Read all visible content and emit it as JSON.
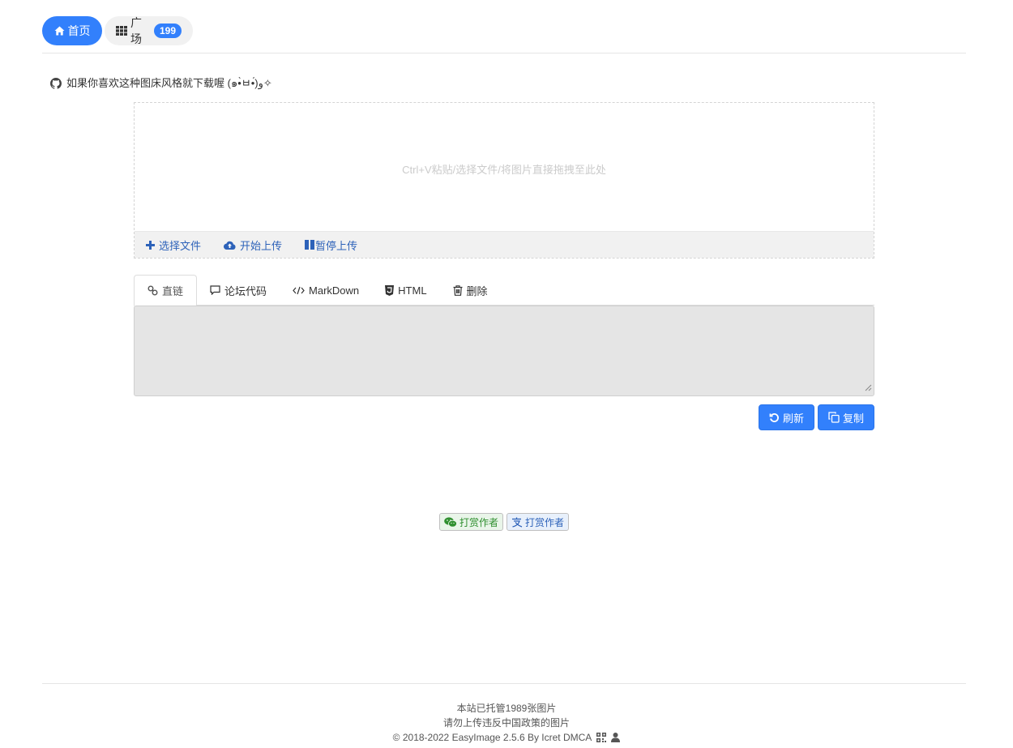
{
  "nav": {
    "home_label": "首页",
    "square_label": "广场",
    "square_count": "199"
  },
  "notice": {
    "text": "如果你喜欢这种图床风格就下载喔 (๑•̀ㅂ•́)و✧"
  },
  "upload": {
    "drop_hint": "Ctrl+V粘贴/选择文件/将图片直接拖拽至此处",
    "choose_label": "选择文件",
    "start_label": "开始上传",
    "pause_label": "暂停上传"
  },
  "tabs": {
    "direct_label": "直链",
    "forum_label": "论坛代码",
    "markdown_label": "MarkDown",
    "html_label": "HTML",
    "delete_label": "删除"
  },
  "result": {
    "value": ""
  },
  "actions": {
    "refresh_label": "刷新",
    "copy_label": "复制"
  },
  "donate": {
    "wechat_label": "打赏作者",
    "alipay_label": "打赏作者"
  },
  "footer": {
    "line1": "本站已托管1989张图片",
    "line2": "请勿上传违反中国政策的图片",
    "line3": "© 2018-2022 EasyImage 2.5.6 By Icret DMCA"
  },
  "colors": {
    "primary": "#3280fc",
    "link": "#2d62b9",
    "wechat": "#2f8f2f"
  }
}
